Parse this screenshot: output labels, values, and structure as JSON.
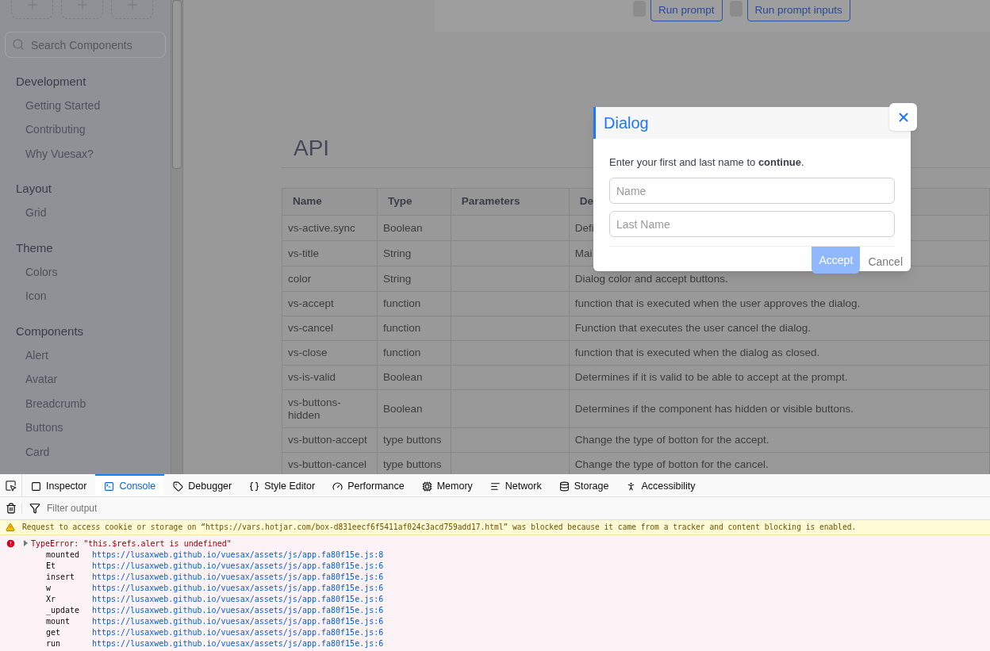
{
  "sidebar": {
    "search": {
      "placeholder": "Search Components"
    },
    "sections": [
      {
        "title": "Development",
        "items": [
          "Getting Started",
          "Contributing",
          "Why Vuesax?"
        ]
      },
      {
        "title": "Layout",
        "items": [
          "Grid"
        ]
      },
      {
        "title": "Theme",
        "items": [
          "Colors",
          "Icon"
        ]
      },
      {
        "title": "Components",
        "items": [
          "Alert",
          "Avatar",
          "Breadcrumb",
          "Buttons",
          "Card"
        ]
      }
    ]
  },
  "top_buttons": [
    {
      "label": "Run prompt",
      "on": false
    },
    {
      "label": "Run prompt inputs",
      "on": false
    }
  ],
  "api": {
    "title": "API",
    "columns": [
      "Name",
      "Type",
      "Parameters",
      "De"
    ],
    "rows": [
      [
        "vs-active.sync",
        "Boolean",
        "",
        "Defi"
      ],
      [
        "vs-title",
        "String",
        "",
        "Mai"
      ],
      [
        "color",
        "String",
        "",
        "Dialog color and accept buttons."
      ],
      [
        "vs-accept",
        "function",
        "",
        "function that is executed when the user approves the dialog."
      ],
      [
        "vs-cancel",
        "function",
        "",
        "Function that executes the user cancel the dialog."
      ],
      [
        "vs-close",
        "function",
        "",
        "function that is executed when the dialog as closed."
      ],
      [
        "vs-is-valid",
        "Boolean",
        "",
        "Determines if it is valid to be able to accept at the prompt."
      ],
      [
        "vs-buttons-hidden",
        "Boolean",
        "",
        "Determines if the component has hidden or visible buttons."
      ],
      [
        "vs-button-accept",
        "type buttons",
        "",
        "Change the type of botton for the accept."
      ],
      [
        "vs-button-cancel",
        "type buttons",
        "",
        "Change the type of botton for the cancel."
      ]
    ]
  },
  "dialog": {
    "title": "Dialog",
    "message": "Enter your first and last name to **continue**.",
    "fields": [
      {
        "placeholder": "Name"
      },
      {
        "placeholder": "Last Name"
      }
    ],
    "accept": {
      "label": "Accept",
      "disabled": true
    },
    "cancel": "Cancel"
  },
  "devtools": {
    "tabs": [
      {
        "label": "Inspector",
        "selected": false
      },
      {
        "label": "Console",
        "selected": true
      },
      {
        "label": "Debugger",
        "selected": false
      },
      {
        "label": "Style Editor",
        "selected": false
      },
      {
        "label": "Performance",
        "selected": false
      },
      {
        "label": "Memory",
        "selected": false
      },
      {
        "label": "Network",
        "selected": false
      },
      {
        "label": "Storage",
        "selected": false
      },
      {
        "label": "Accessibility",
        "selected": false
      }
    ],
    "filter": {
      "placeholder": "Filter output"
    },
    "messages": [
      {
        "kind": "warning",
        "text": "Request to access cookie or storage on “https://vars.hotjar.com/box-d831eecf6f5411af024c3acd759add17.html” was blocked because it came from a tracker and content blocking is enabled."
      },
      {
        "kind": "error",
        "expanded": false,
        "text": "TypeError: \"this.$refs.alert is undefined\"",
        "stack": [
          {
            "fn": "mounted",
            "url": "https://lusaxweb.github.io/vuesax/assets/js/app.fa80f15e.js:8"
          },
          {
            "fn": "Et",
            "url": "https://lusaxweb.github.io/vuesax/assets/js/app.fa80f15e.js:6"
          },
          {
            "fn": "insert",
            "url": "https://lusaxweb.github.io/vuesax/assets/js/app.fa80f15e.js:6"
          },
          {
            "fn": "w",
            "url": "https://lusaxweb.github.io/vuesax/assets/js/app.fa80f15e.js:6"
          },
          {
            "fn": "Xr",
            "url": "https://lusaxweb.github.io/vuesax/assets/js/app.fa80f15e.js:6"
          },
          {
            "fn": "_update",
            "url": "https://lusaxweb.github.io/vuesax/assets/js/app.fa80f15e.js:6"
          },
          {
            "fn": "mount",
            "url": "https://lusaxweb.github.io/vuesax/assets/js/app.fa80f15e.js:6"
          },
          {
            "fn": "get",
            "url": "https://lusaxweb.github.io/vuesax/assets/js/app.fa80f15e.js:6"
          },
          {
            "fn": "run",
            "url": "https://lusaxweb.github.io/vuesax/assets/js/app.fa80f15e.js:6"
          }
        ]
      }
    ]
  }
}
